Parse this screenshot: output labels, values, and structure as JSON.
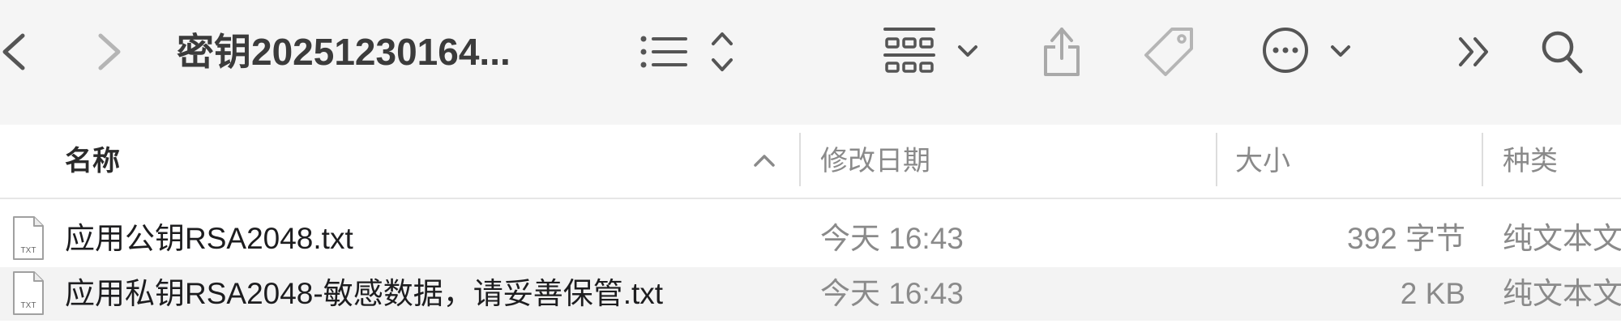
{
  "toolbar": {
    "title": "密钥20251230164...",
    "icons": [
      "chevron-left-icon",
      "chevron-right-icon",
      "list-view-icon",
      "sort-updown-icon",
      "grid-view-icon",
      "chevron-down-icon",
      "share-icon",
      "tag-icon",
      "more-icon",
      "chevron-down-icon",
      "double-chevron-right-icon",
      "search-icon"
    ]
  },
  "columns": {
    "name": "名称",
    "date": "修改日期",
    "size": "大小",
    "kind": "种类"
  },
  "files": [
    {
      "name": "应用公钥RSA2048.txt",
      "date": "今天 16:43",
      "size": "392 字节",
      "kind": "纯文本文稿",
      "icon": "txt-file-icon",
      "icon_label": "TXT"
    },
    {
      "name": "应用私钥RSA2048-敏感数据，请妥善保管.txt",
      "date": "今天 16:43",
      "size": "2 KB",
      "kind": "纯文本文稿",
      "icon": "txt-file-icon",
      "icon_label": "TXT"
    }
  ],
  "colors": {
    "toolbar_bg": "#f5f5f5",
    "alt_row": "#f3f3f3",
    "secondary_text": "#8a8a8a",
    "icon_gray": "#555555"
  }
}
